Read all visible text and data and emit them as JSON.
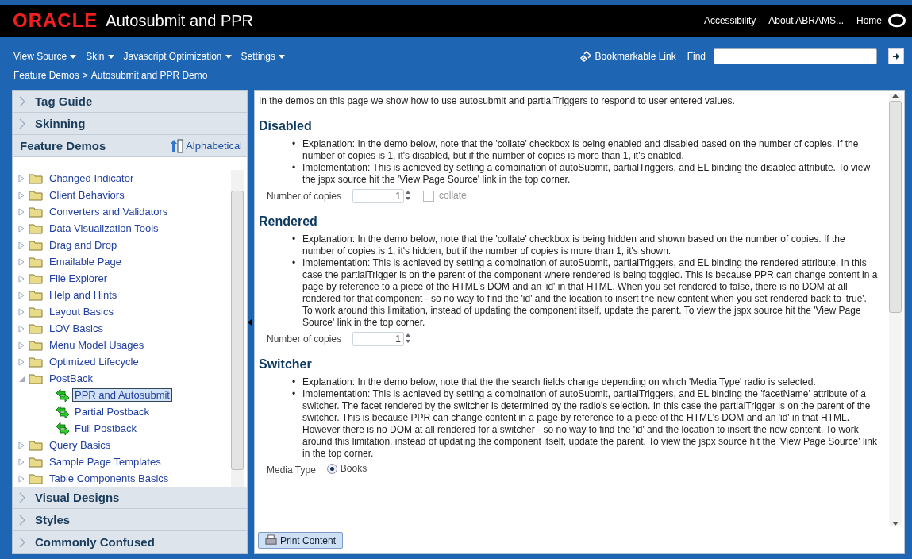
{
  "header": {
    "logo": "ORACLE",
    "title": "Autosubmit and PPR",
    "links": [
      "Accessibility",
      "About ABRAMS...",
      "Home"
    ]
  },
  "toolbar": {
    "menus": [
      "View Source",
      "Skin",
      "Javascript Optimization",
      "Settings"
    ],
    "bookmark": "Bookmarkable Link",
    "find_label": "Find"
  },
  "breadcrumb": [
    "Feature Demos",
    "Autosubmit and PPR Demo"
  ],
  "breadcrumb_separator": ">",
  "sidebar": {
    "panels": [
      {
        "title": "Tag Guide",
        "expanded": false
      },
      {
        "title": "Skinning",
        "expanded": false
      },
      {
        "title": "Feature Demos",
        "expanded": true,
        "sort_label": "Alphabetical"
      },
      {
        "title": "Visual Designs",
        "expanded": false
      },
      {
        "title": "Styles",
        "expanded": false
      },
      {
        "title": "Commonly Confused",
        "expanded": false
      }
    ],
    "tree": [
      {
        "label": "Changed Indicator",
        "kind": "folder",
        "expanded": false,
        "selected": false
      },
      {
        "label": "Client Behaviors",
        "kind": "folder",
        "expanded": false,
        "selected": false
      },
      {
        "label": "Converters and Validators",
        "kind": "folder",
        "expanded": false,
        "selected": false
      },
      {
        "label": "Data Visualization Tools",
        "kind": "folder",
        "expanded": false,
        "selected": false
      },
      {
        "label": "Drag and Drop",
        "kind": "folder",
        "expanded": false,
        "selected": false
      },
      {
        "label": "Emailable Page",
        "kind": "folder",
        "expanded": false,
        "selected": false
      },
      {
        "label": "File Explorer",
        "kind": "folder",
        "expanded": false,
        "selected": false
      },
      {
        "label": "Help and Hints",
        "kind": "folder",
        "expanded": false,
        "selected": false
      },
      {
        "label": "Layout Basics",
        "kind": "folder",
        "expanded": false,
        "selected": false
      },
      {
        "label": "LOV Basics",
        "kind": "folder",
        "expanded": false,
        "selected": false
      },
      {
        "label": "Menu Model Usages",
        "kind": "folder",
        "expanded": false,
        "selected": false
      },
      {
        "label": "Optimized Lifecycle",
        "kind": "folder",
        "expanded": false,
        "selected": false
      },
      {
        "label": "PostBack",
        "kind": "folder",
        "expanded": true,
        "selected": false,
        "children": [
          {
            "label": "PPR and Autosubmit",
            "kind": "demo",
            "selected": true
          },
          {
            "label": "Partial Postback",
            "kind": "demo",
            "selected": false
          },
          {
            "label": "Full Postback",
            "kind": "demo",
            "selected": false
          }
        ]
      },
      {
        "label": "Query Basics",
        "kind": "folder",
        "expanded": false,
        "selected": false
      },
      {
        "label": "Sample Page Templates",
        "kind": "folder",
        "expanded": false,
        "selected": false
      },
      {
        "label": "Table Components Basics",
        "kind": "folder",
        "expanded": false,
        "selected": false
      }
    ]
  },
  "content": {
    "intro": "In the demos on this page we show how to use autosubmit and partialTriggers to respond to user entered values.",
    "sections": [
      {
        "title": "Disabled",
        "bullets": [
          {
            "marker": "•",
            "text": "Explanation: In the demo below, note that the 'collate' checkbox is being enabled and disabled based on the number of copies. If the number of copies is 1, it's disabled, but if the number of copies is more than 1, it's enabled."
          },
          {
            "marker": "•",
            "text": "Implementation: This is achieved by setting a combination of autoSubmit, partialTriggers, and EL binding the disabled attribute. To view the jspx source hit the 'View Page Source' link in the top corner."
          }
        ],
        "controls": [
          {
            "kind": "spinner",
            "label": "Number of copies",
            "value": "1"
          },
          {
            "kind": "checkbox",
            "label": "collate",
            "checked": false,
            "disabled": true
          }
        ]
      },
      {
        "title": "Rendered",
        "bullets": [
          {
            "marker": "•",
            "text": "Explanation: In the demo below, note that the 'collate' checkbox is being hidden and shown based on the number of copies. If the number of copies is 1, it's hidden, but if the number of copies is more than 1, it's shown."
          },
          {
            "marker": "•",
            "text": "Implementation: This is achieved by setting a combination of autoSubmit, partialTriggers, and EL binding the rendered attribute. In this case the partialTrigger is on the parent of the component where rendered is being toggled. This is because PPR can change content in a page by reference to a piece of the HTML's DOM and an 'id' in that HTML. When you set rendered to false, there is no DOM at all rendered for that component - so no way to find the 'id' and the location to insert the new content when you set rendered back to 'true'. To work around this limitation, instead of updating the component itself, update the parent. To view the jspx source hit the 'View Page Source' link in the top corner."
          }
        ],
        "controls": [
          {
            "kind": "spinner",
            "label": "Number of copies",
            "value": "1"
          }
        ]
      },
      {
        "title": "Switcher",
        "bullets": [
          {
            "marker": "•",
            "text": "Explanation: In the demo below, note that the the search fields change depending on which 'Media Type' radio is selected."
          },
          {
            "marker": "•",
            "text": "Implementation: This is achieved by setting a combination of autoSubmit, partialTriggers, and EL binding the 'facetName' attribute of a switcher. The facet rendered by the switcher is determined by the radio's selection. In this case the partialTrigger is on the parent of the switcher. This is because PPR can change content in a page by reference to a piece of the HTML's DOM and an 'id' in that HTML. However there is no DOM at all rendered for a switcher - so no way to find the 'id' and the location to insert the new content. To work around this limitation, instead of updating the component itself, update the parent. To view the jspx source hit the 'View Page Source' link in the top corner."
          }
        ],
        "controls": [
          {
            "kind": "radio",
            "label": "Media Type",
            "options": [
              {
                "label": "Books",
                "selected": true
              }
            ]
          }
        ]
      }
    ]
  },
  "print_button": "Print Content"
}
